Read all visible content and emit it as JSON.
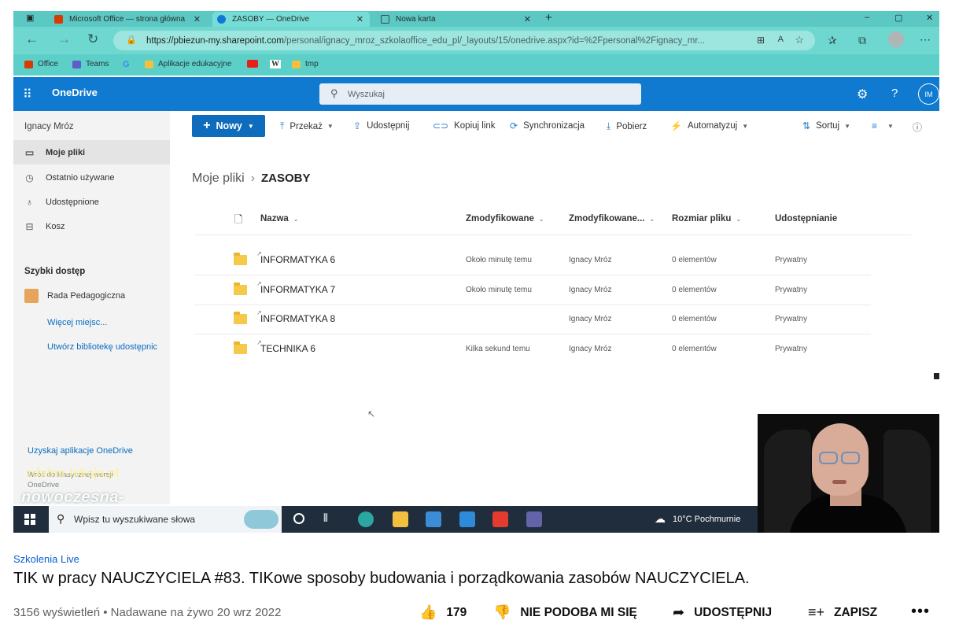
{
  "browser": {
    "tabs": [
      {
        "label": "Microsoft Office — strona główna",
        "color": "#d83b01"
      },
      {
        "label": "ZASOBY — OneDrive",
        "color": "#0f78d4"
      },
      {
        "label": "Nowa karta",
        "color": "#3b4a4a"
      }
    ],
    "new_tab": "+",
    "window_controls": {
      "minimize": "–",
      "maximize": "▢",
      "close": "✕"
    },
    "url_host": "https://pbiezun-my.sharepoint.com",
    "url_path": "/personal/ignacy_mroz_szkolaoffice_edu_pl/_layouts/15/onedrive.aspx?id=%2Fpersonal%2Fignacy_mr...",
    "favorites": [
      {
        "label": "Office",
        "color": "#d83b01"
      },
      {
        "label": "Teams",
        "color": "#5b5fc7"
      },
      {
        "label": "",
        "icon": "google-icon",
        "color": "#fff"
      },
      {
        "label": "Aplikacje edukacyjne",
        "color": "#f3c03f"
      },
      {
        "label": "",
        "icon": "youtube-icon",
        "color": "#e62117"
      },
      {
        "label": "",
        "icon": "wikipedia-icon",
        "color": "#fff"
      },
      {
        "label": "tmp",
        "color": "#f3c03f"
      }
    ]
  },
  "onedrive": {
    "brand": "OneDrive",
    "search_placeholder": "Wyszukaj",
    "avatar_initials": "IM",
    "user_name": "Ignacy Mróz",
    "nav": [
      {
        "label": "Moje pliki",
        "icon": "folder-icon",
        "glyph": "▭"
      },
      {
        "label": "Ostatnio używane",
        "icon": "clock-icon",
        "glyph": "◷"
      },
      {
        "label": "Udostępnione",
        "icon": "share-people-icon",
        "glyph": "♁"
      },
      {
        "label": "Kosz",
        "icon": "trash-icon",
        "glyph": "⊟"
      }
    ],
    "quick_access_title": "Szybki dostęp",
    "quick_items": [
      {
        "label": "Rada Pedagogiczna"
      }
    ],
    "more_places": "Więcej miejsc...",
    "create_library": "Utwórz bibliotekę udostępnic",
    "get_apps": "Uzyskaj aplikacje OneDrive",
    "side_footer": "Wróć do klasycznej wersji\nOneDrive",
    "watermark_1": "zdalna-lekcja.pl",
    "watermark_2": "nowoczesna-edukacja.pl",
    "commands": {
      "new": "Nowy",
      "transfer": "Przekaż",
      "share": "Udostępnij",
      "copy_link": "Kopiuj link",
      "sync": "Synchronizacja",
      "download": "Pobierz",
      "automate": "Automatyzuj",
      "sort": "Sortuj"
    },
    "breadcrumb": {
      "root": "Moje pliki",
      "current": "ZASOBY"
    },
    "columns": {
      "name": "Nazwa",
      "modified": "Zmodyfikowane",
      "modified_by": "Zmodyfikowane...",
      "size": "Rozmiar pliku",
      "sharing": "Udostępnianie"
    },
    "rows": [
      {
        "name": "INFORMATYKA 6",
        "modified": "Około minutę temu",
        "by": "Ignacy Mróz",
        "size": "0 elementów",
        "sharing": "Prywatny"
      },
      {
        "name": "INFORMATYKA 7",
        "modified": "Około minutę temu",
        "by": "Ignacy Mróz",
        "size": "0 elementów",
        "sharing": "Prywatny"
      },
      {
        "name": "INFORMATYKA 8",
        "modified": "",
        "by": "Ignacy Mróz",
        "size": "0 elementów",
        "sharing": "Prywatny"
      },
      {
        "name": "TECHNIKA 6",
        "modified": "Kilka sekund temu",
        "by": "Ignacy Mróz",
        "size": "0 elementów",
        "sharing": "Prywatny"
      }
    ]
  },
  "taskbar": {
    "search_placeholder": "Wpisz tu wyszukiwane słowa",
    "weather": "10°C Pochmurnie",
    "apps": [
      {
        "icon": "task-view-icon",
        "color": "#1f2d3c"
      },
      {
        "icon": "widgets-icon",
        "color": "#1f2d3c"
      },
      {
        "icon": "edge-icon",
        "color": "#2aa7a0"
      },
      {
        "icon": "file-explorer-icon",
        "color": "#f2c03f"
      },
      {
        "icon": "store-icon",
        "color": "#3a8dd6"
      },
      {
        "icon": "mail-icon",
        "color": "#2f8ad8"
      },
      {
        "icon": "anydesk-icon",
        "color": "#e33b2e"
      },
      {
        "icon": "teams-icon",
        "color": "#6264a7"
      }
    ]
  },
  "youtube": {
    "channel": "Szkolenia Live",
    "title": "TIK w pracy NAUCZYCIELA #83. TIKowe sposoby budowania i porządkowania zasobów NAUCZYCIELA.",
    "meta": "3156 wyświetleń • Nadawane na żywo 20 wrz 2022",
    "likes": "179",
    "dislike_label": "NIE PODOBA MI SIĘ",
    "share_label": "UDOSTĘPNIJ",
    "save_label": "ZAPISZ",
    "more": "•••"
  }
}
